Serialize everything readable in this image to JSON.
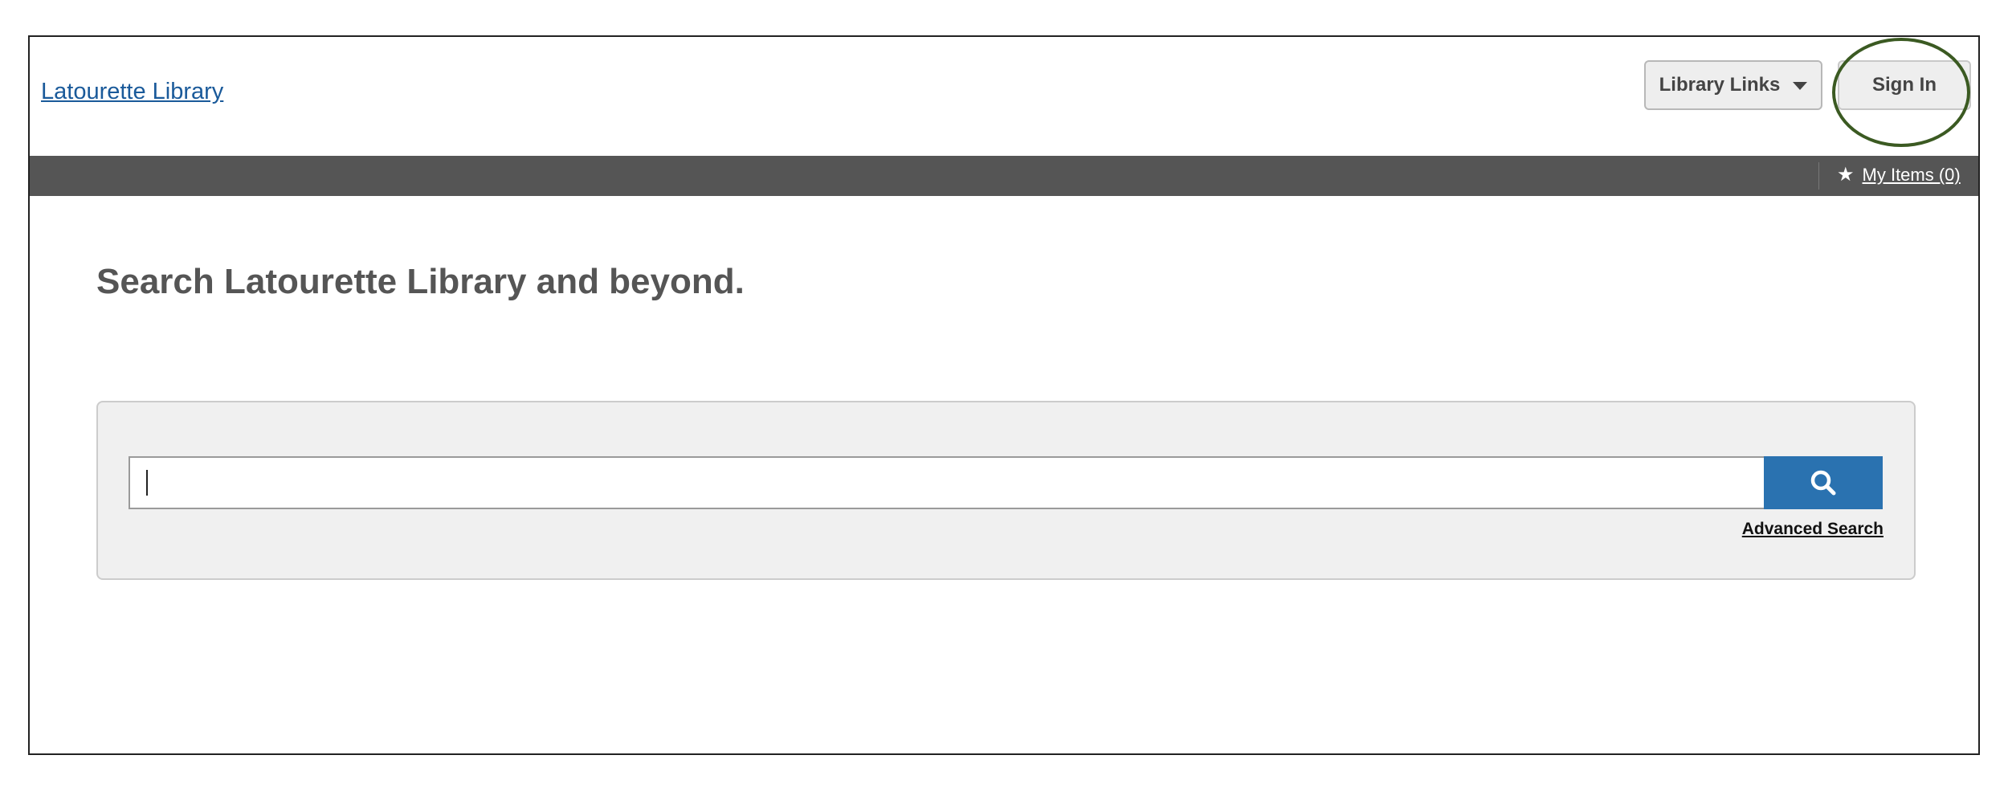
{
  "header": {
    "site_title": "Latourette Library",
    "library_links_label": "Library Links",
    "signin_label": "Sign In",
    "annotation_color": "#3b5a22"
  },
  "navbar": {
    "my_items_label": "My Items (0)",
    "background": "#555555",
    "icon": "star-icon"
  },
  "main": {
    "heading": "Search Latourette Library and beyond.",
    "search": {
      "value": "",
      "placeholder": "",
      "button_icon": "search-icon",
      "button_color": "#2a72b0",
      "advanced_label": "Advanced Search"
    }
  }
}
